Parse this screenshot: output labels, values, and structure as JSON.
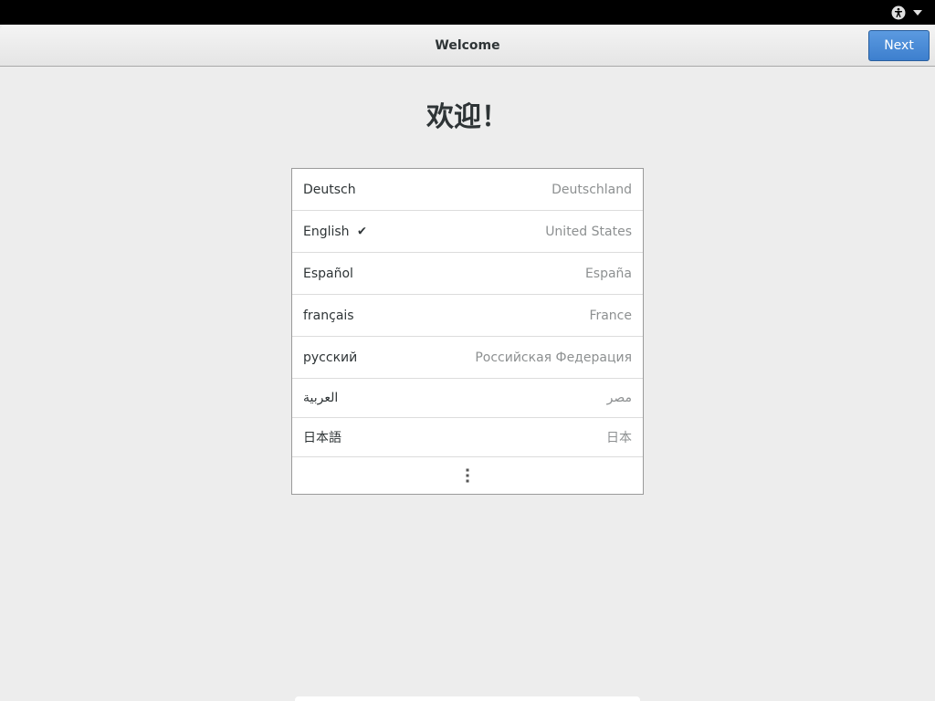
{
  "topbar": {
    "accessibility_icon": "accessibility-icon",
    "menu_arrow_icon": "chevron-down-icon"
  },
  "header": {
    "title": "Welcome",
    "next_label": "Next",
    "next_color": "#4a8cd9"
  },
  "welcome_heading": "欢迎！",
  "languages": [
    {
      "name": "Deutsch",
      "region": "Deutschland",
      "selected": false
    },
    {
      "name": "English",
      "region": "United States",
      "selected": true,
      "check": "✔"
    },
    {
      "name": "Español",
      "region": "España",
      "selected": false
    },
    {
      "name": "français",
      "region": "France",
      "selected": false
    },
    {
      "name": "русский",
      "region": "Российская Федерация",
      "selected": false
    },
    {
      "name": "العربية",
      "region": "مصر",
      "selected": false
    },
    {
      "name": "日本語",
      "region": "日本",
      "selected": false
    }
  ],
  "more_icon": "more-vertical-icon"
}
